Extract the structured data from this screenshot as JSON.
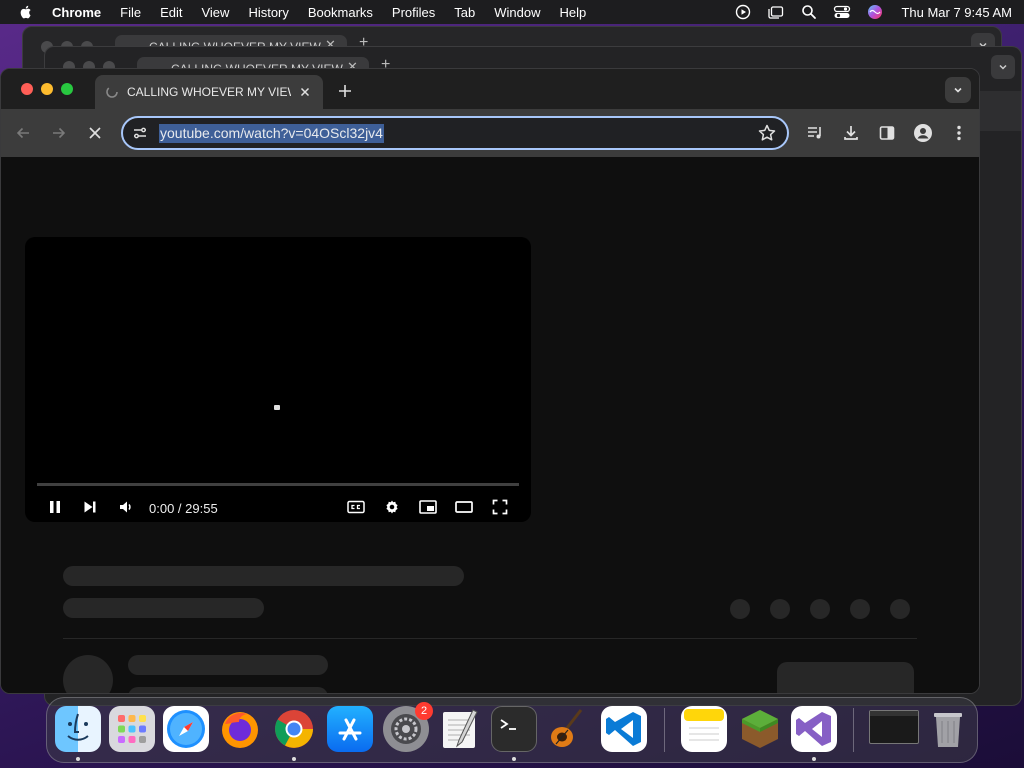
{
  "menubar": {
    "app_name": "Chrome",
    "items": [
      "File",
      "Edit",
      "View",
      "History",
      "Bookmarks",
      "Profiles",
      "Tab",
      "Window",
      "Help"
    ],
    "clock": "Thu Mar 7  9:45 AM"
  },
  "background_windows": {
    "tab_title_1": "CALLING WHOEVER MY VIEW",
    "tab_title_2": "CALLING WHOEVER MY VIEW"
  },
  "browser": {
    "tab": {
      "title": "CALLING WHOEVER MY VIEWERS"
    },
    "omnibox": {
      "url": "youtube.com/watch?v=04OScl32jv4"
    }
  },
  "player": {
    "time": "0:00 / 29:55",
    "progress": 0
  },
  "dock": {
    "apps": [
      "finder",
      "launchpad",
      "safari",
      "firefox",
      "chrome",
      "app-store",
      "system-settings",
      "textedit",
      "terminal",
      "garageband",
      "vscode",
      "notes",
      "minecraft",
      "visual-studio",
      "window-preview",
      "trash"
    ],
    "settings_badge": "2"
  }
}
